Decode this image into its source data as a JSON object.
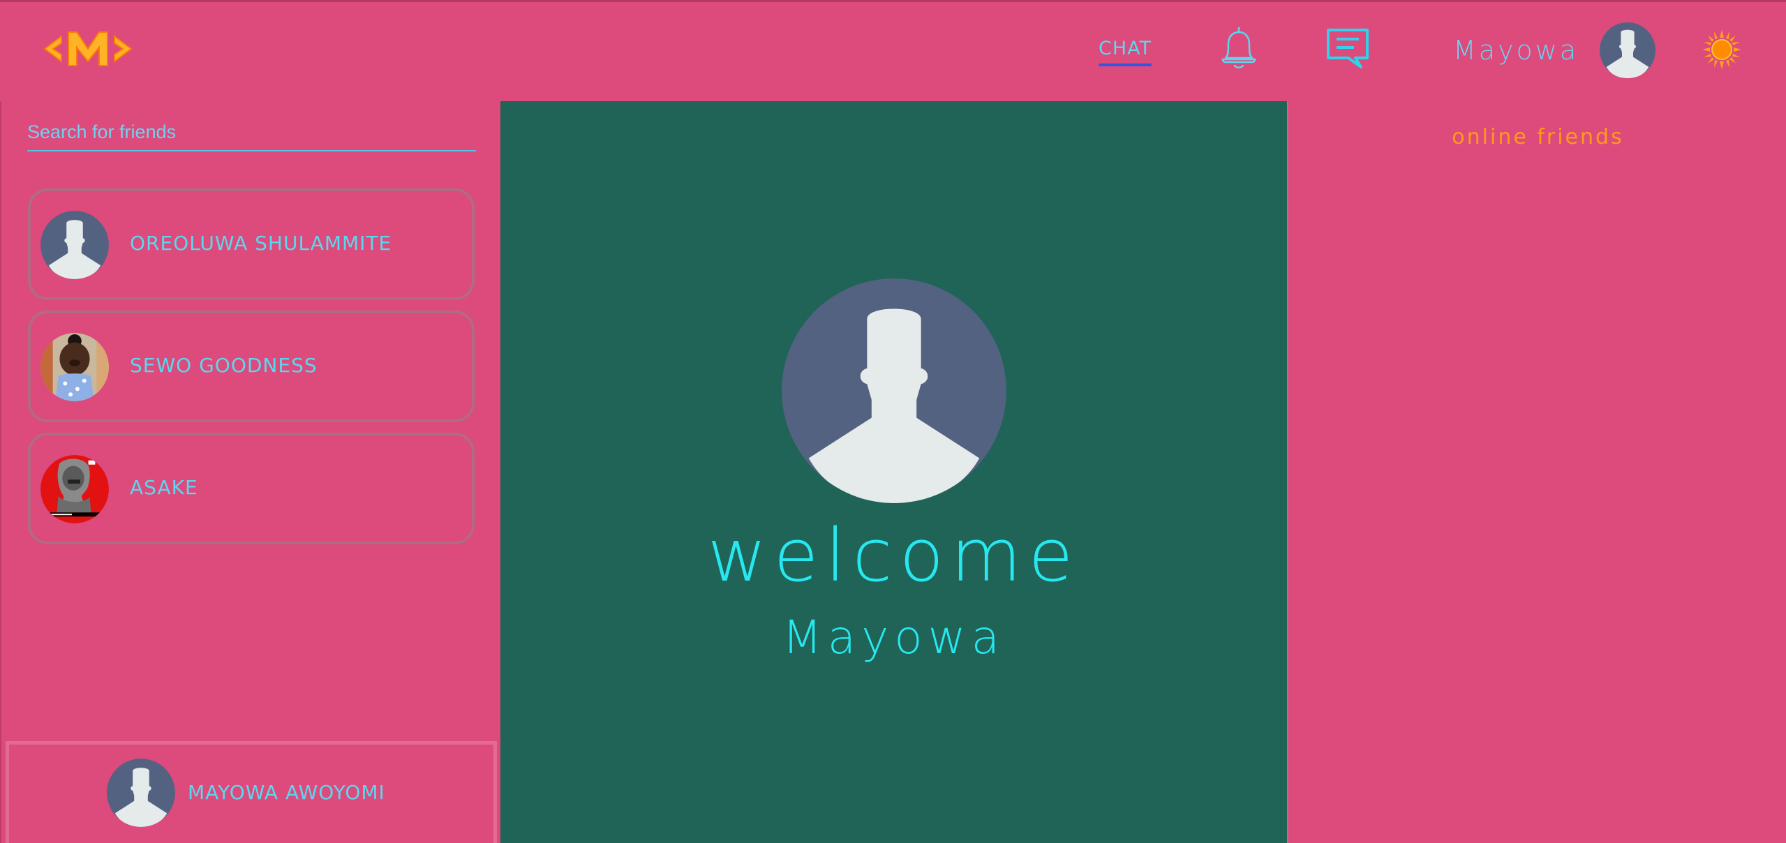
{
  "header": {
    "logo_text": "<M>",
    "nav_chat": "CHAT",
    "user_name": "Mayowa"
  },
  "sidebar": {
    "search_placeholder": "Search for friends",
    "friends": [
      {
        "name": "OREOLUWA SHULAMMITE",
        "avatar": "default-avatar"
      },
      {
        "name": "SEWO GOODNESS",
        "avatar": "photo-child"
      },
      {
        "name": "ASAKE",
        "avatar": "photo-artist-red"
      }
    ],
    "current_user": {
      "name": "MAYOWA AWOYOMI",
      "avatar": "default-avatar"
    }
  },
  "main": {
    "welcome": "welcome",
    "name": "Mayowa"
  },
  "right_panel": {
    "title": "online friends"
  },
  "colors": {
    "background": "#dd4a7c",
    "center_panel": "#1f6457",
    "accent_cyan": "#27e8f0",
    "text_cyan": "#5ad8ef",
    "orange": "#ff9a1a",
    "avatar_bg": "#546282",
    "avatar_fg": "#e5eaeb"
  },
  "icons": {
    "logo": "m-logo",
    "notifications": "bell-icon",
    "messages": "message-icon",
    "theme": "sun-icon"
  }
}
